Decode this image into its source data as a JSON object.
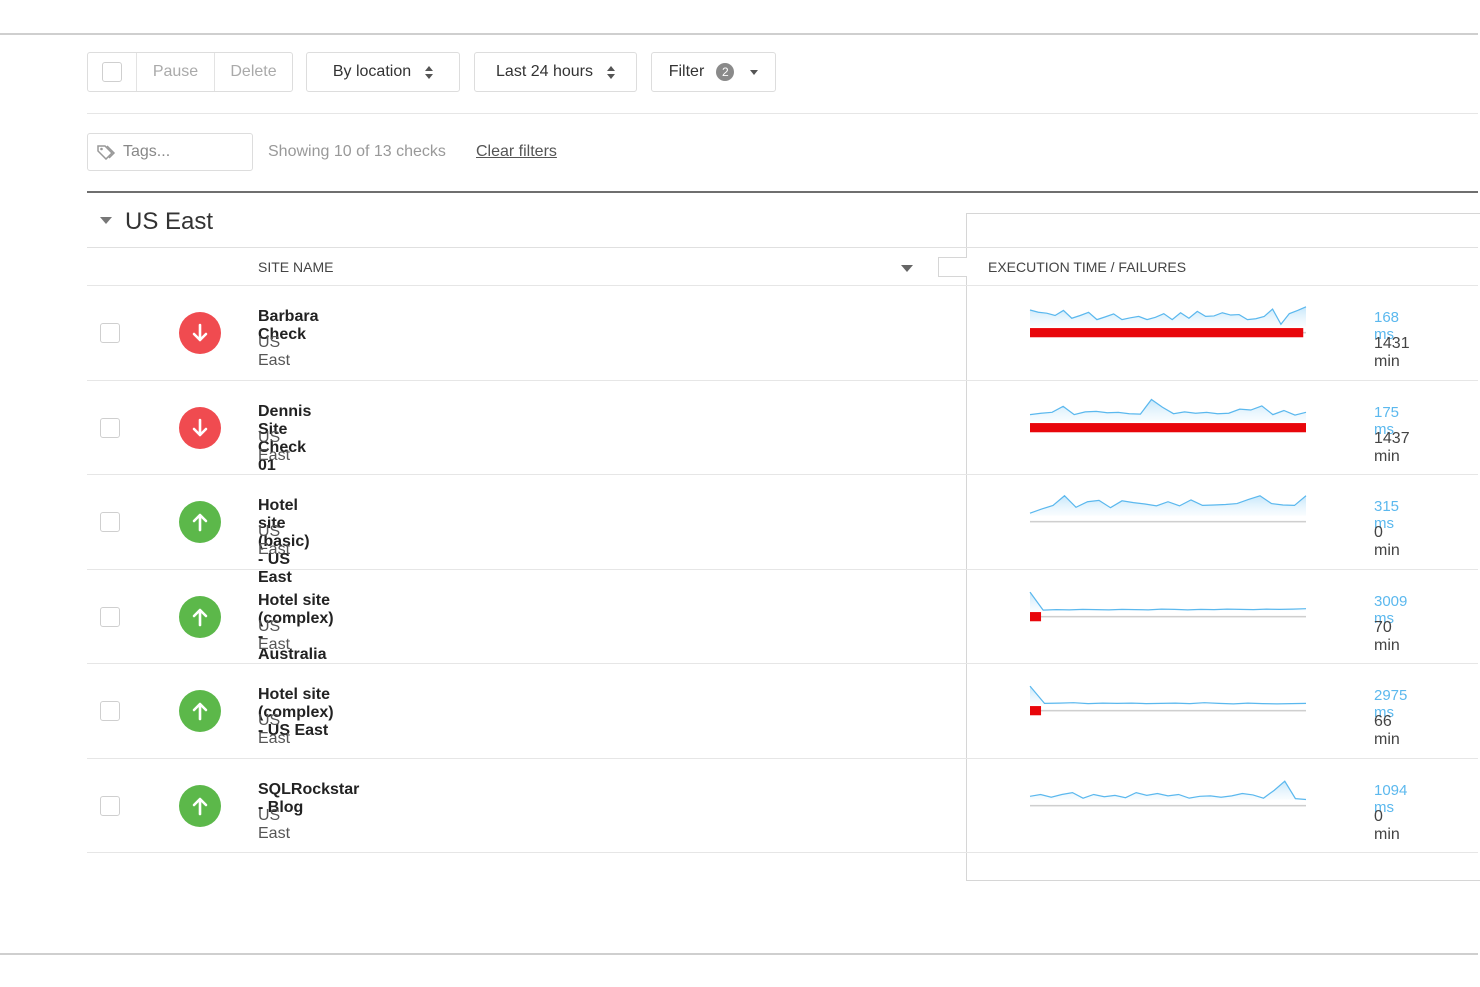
{
  "toolbar": {
    "pause_label": "Pause",
    "delete_label": "Delete",
    "group_by_label": "By location",
    "time_range_label": "Last 24 hours",
    "filter_label": "Filter",
    "filter_count": "2"
  },
  "filters": {
    "tags_placeholder": "Tags...",
    "showing_text": "Showing 10 of 13 checks",
    "clear_filters_label": "Clear filters"
  },
  "group": {
    "title": "US East"
  },
  "columns": {
    "site_name": "SITE NAME",
    "execution": "EXECUTION TIME / FAILURES"
  },
  "colors": {
    "down": "#f04b50",
    "up": "#5cb84a",
    "failure_bar": "#e8060b",
    "spark_line": "#5bb8ee",
    "ms_text": "#5bb8ee"
  },
  "rows": [
    {
      "name": "Barbara Check",
      "location": "US East",
      "status": "down",
      "exec_ms": "168 ms",
      "downtime": "1431 min",
      "failure_fraction": 0.99,
      "spark": [
        0.72,
        0.62,
        0.58,
        0.48,
        0.7,
        0.36,
        0.48,
        0.62,
        0.3,
        0.42,
        0.55,
        0.3,
        0.38,
        0.44,
        0.3,
        0.4,
        0.56,
        0.3,
        0.6,
        0.36,
        0.66,
        0.44,
        0.46,
        0.6,
        0.5,
        0.52,
        0.3,
        0.34,
        0.44,
        0.76,
        0.1,
        0.56,
        0.7,
        0.86
      ]
    },
    {
      "name": "Dennis Site Check 01",
      "location": "US East",
      "status": "down",
      "exec_ms": "175 ms",
      "downtime": "1437 min",
      "failure_fraction": 1.0,
      "spark": [
        0.3,
        0.36,
        0.4,
        0.66,
        0.3,
        0.42,
        0.44,
        0.38,
        0.4,
        0.34,
        0.32,
        0.96,
        0.62,
        0.34,
        0.42,
        0.36,
        0.4,
        0.34,
        0.36,
        0.54,
        0.5,
        0.68,
        0.3,
        0.48,
        0.28,
        0.4
      ]
    },
    {
      "name": "Hotel site (basic) - US East",
      "location": "US East",
      "status": "up",
      "exec_ms": "315 ms",
      "downtime": "0 min",
      "failure_fraction": 0.0,
      "spark": [
        0.1,
        0.28,
        0.44,
        0.86,
        0.36,
        0.6,
        0.66,
        0.34,
        0.64,
        0.56,
        0.5,
        0.42,
        0.6,
        0.42,
        0.68,
        0.44,
        0.46,
        0.48,
        0.52,
        0.7,
        0.86,
        0.52,
        0.46,
        0.44,
        0.86
      ]
    },
    {
      "name": "Hotel site (complex) - Australia",
      "location": "US East",
      "status": "up",
      "exec_ms": "3009 ms",
      "downtime": "70 min",
      "failure_fraction": 0.04,
      "spark": [
        0.8,
        0.02,
        0.04,
        0.03,
        0.05,
        0.04,
        0.03,
        0.05,
        0.04,
        0.03,
        0.06,
        0.05,
        0.03,
        0.05,
        0.04,
        0.06,
        0.05,
        0.04,
        0.06,
        0.05,
        0.06,
        0.08
      ]
    },
    {
      "name": "Hotel site (complex) - US East",
      "location": "US East",
      "status": "up",
      "exec_ms": "2975 ms",
      "downtime": "66 min",
      "failure_fraction": 0.04,
      "spark": [
        0.8,
        0.05,
        0.06,
        0.08,
        0.04,
        0.06,
        0.05,
        0.06,
        0.04,
        0.05,
        0.06,
        0.04,
        0.08,
        0.05,
        0.03,
        0.06,
        0.04,
        0.03,
        0.04,
        0.05
      ]
    },
    {
      "name": "SQLRockstar - Blog",
      "location": "US East",
      "status": "up",
      "exec_ms": "1094 ms",
      "downtime": "0 min",
      "failure_fraction": 0.0,
      "spark": [
        0.14,
        0.22,
        0.1,
        0.22,
        0.3,
        0.06,
        0.22,
        0.12,
        0.18,
        0.08,
        0.3,
        0.18,
        0.26,
        0.16,
        0.22,
        0.06,
        0.14,
        0.16,
        0.1,
        0.16,
        0.26,
        0.2,
        0.06,
        0.4,
        0.8,
        0.04,
        0.0
      ]
    }
  ]
}
